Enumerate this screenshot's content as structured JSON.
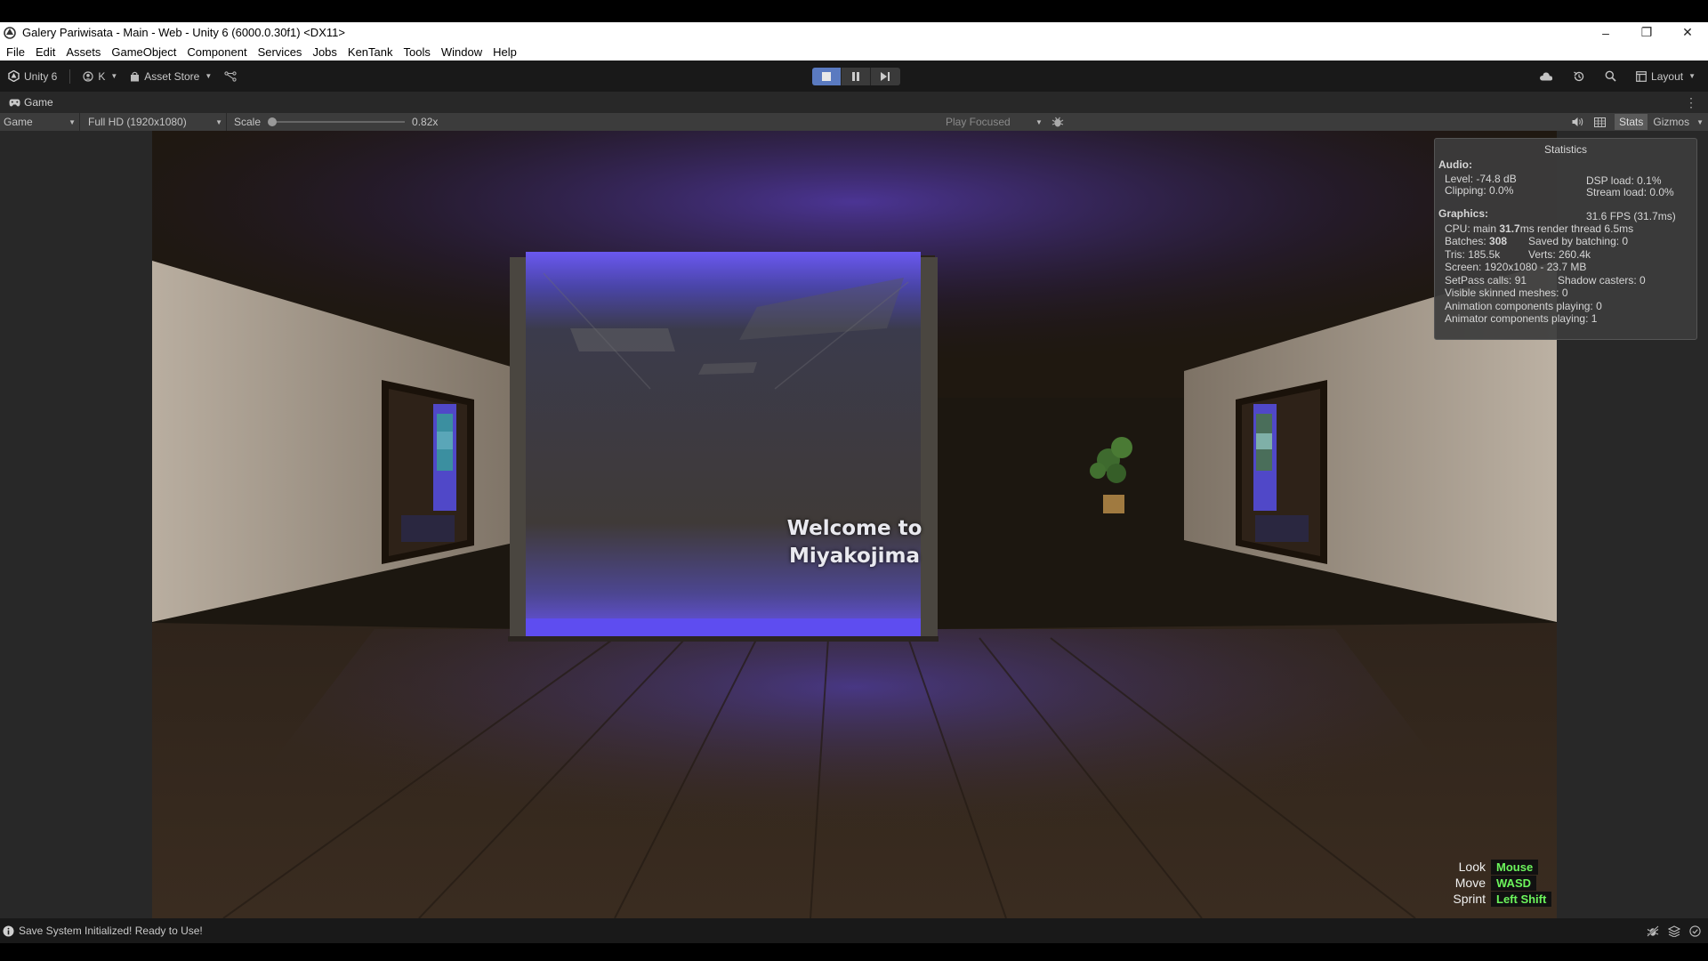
{
  "window": {
    "title": "Galery Pariwisata - Main - Web - Unity 6 (6000.0.30f1) <DX11>",
    "controls": {
      "minimize": "–",
      "restore": "❐",
      "close": "✕"
    }
  },
  "menu": [
    "File",
    "Edit",
    "Assets",
    "GameObject",
    "Component",
    "Services",
    "Jobs",
    "KenTank",
    "Tools",
    "Window",
    "Help"
  ],
  "toolbar": {
    "unity_label": "Unity 6",
    "account_label": "K",
    "asset_store_label": "Asset Store",
    "layout_label": "Layout",
    "play_state": "playing"
  },
  "tab": {
    "label": "Game"
  },
  "game_toolbar": {
    "display": "Game",
    "resolution": "Full HD (1920x1080)",
    "scale_label": "Scale",
    "scale_value": "0.82x",
    "play_mode": "Play Focused",
    "stats": "Stats",
    "gizmos": "Gizmos"
  },
  "scene": {
    "welcome_line1": "Welcome to",
    "welcome_line2": "Miyakojima"
  },
  "statistics": {
    "title": "Statistics",
    "audio_header": "Audio:",
    "level": "Level: -74.8 dB",
    "dsp": "DSP load: 0.1%",
    "clipping": "Clipping: 0.0%",
    "stream": "Stream load: 0.0%",
    "graphics_header": "Graphics:",
    "fps": "31.6 FPS (31.7ms)",
    "cpu_prefix": "CPU: main ",
    "cpu_main": "31.7",
    "cpu_suffix": "ms  render thread 6.5ms",
    "batches_prefix": "Batches: ",
    "batches": "308",
    "saved_batching": "Saved by batching: 0",
    "tris": "Tris: 185.5k",
    "verts": "Verts: 260.4k",
    "screen": "Screen: 1920x1080 - 23.7 MB",
    "setpass": "SetPass calls: 91",
    "shadow": "Shadow casters: 0",
    "skinned": "Visible skinned meshes: 0",
    "anim_components": "Animation components playing: 0",
    "animator_components": "Animator components playing: 1"
  },
  "controls_legend": [
    {
      "label": "Look",
      "key": "Mouse"
    },
    {
      "label": "Move",
      "key": "WASD"
    },
    {
      "label": "Sprint",
      "key": "Left Shift"
    }
  ],
  "status": {
    "message": "Save System Initialized! Ready to Use!"
  },
  "colors": {
    "accent_play": "#5a7ac0",
    "key_green": "#6cf55c",
    "glow": "#5a4cf0"
  }
}
